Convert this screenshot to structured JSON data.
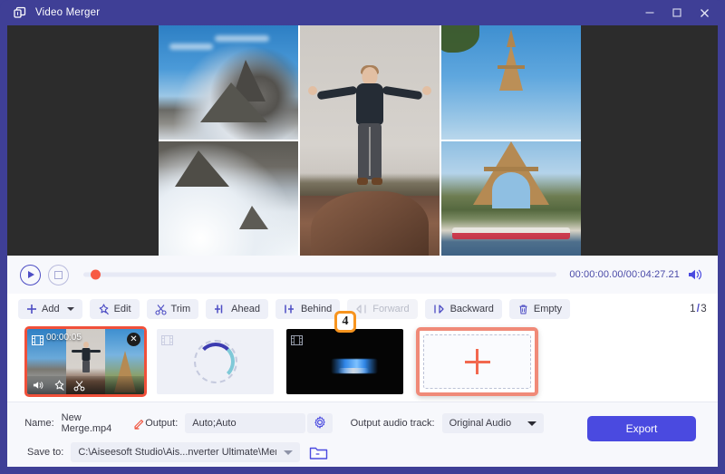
{
  "window": {
    "title": "Video Merger",
    "logo_icon": "windows-stack-icon",
    "controls": [
      {
        "name": "minimize-button",
        "icon": "minimize-icon"
      },
      {
        "name": "maximize-button",
        "icon": "maximize-icon"
      },
      {
        "name": "close-button",
        "icon": "close-icon"
      }
    ],
    "accent_color": "#3f3f96"
  },
  "preview": {
    "name": "video-preview",
    "background_color": "#2c2c2c",
    "collage": {
      "layout": "3-column collage",
      "cells": [
        {
          "name": "collage-cell-mountain-top",
          "subject": "snowy rocky mountain peak under blue sky"
        },
        {
          "name": "collage-cell-mountain-bottom",
          "subject": "snow field with rocky outcrops"
        },
        {
          "name": "collage-cell-man-jumping",
          "subject": "man jumping with arms outstretched above a rock"
        },
        {
          "name": "collage-cell-eiffel-top",
          "subject": "Eiffel Tower upper section against blue sky"
        },
        {
          "name": "collage-cell-eiffel-bottom",
          "subject": "Eiffel Tower base with Seine river boat"
        }
      ]
    }
  },
  "player": {
    "play_button": "play-button",
    "stop_button": "stop-button",
    "timecode": "00:00:00.00/00:04:27.21",
    "current_time": "00:00:00.00",
    "total_time": "00:04:27.21",
    "playhead_percent": 1,
    "volume_icon": "volume-icon"
  },
  "toolbar": {
    "buttons": [
      {
        "label": "Add",
        "icon": "plus-icon",
        "has_caret": true,
        "disabled": false,
        "name": "add-button"
      },
      {
        "label": "Edit",
        "icon": "magic-wand-icon",
        "has_caret": false,
        "disabled": false,
        "name": "edit-button"
      },
      {
        "label": "Trim",
        "icon": "scissors-icon",
        "has_caret": false,
        "disabled": false,
        "name": "trim-button"
      },
      {
        "label": "Ahead",
        "icon": "insert-ahead-icon",
        "has_caret": false,
        "disabled": false,
        "name": "ahead-button"
      },
      {
        "label": "Behind",
        "icon": "insert-behind-icon",
        "has_caret": false,
        "disabled": false,
        "name": "behind-button"
      },
      {
        "label": "Forward",
        "icon": "arrow-left-icon",
        "has_caret": false,
        "disabled": true,
        "name": "forward-button"
      },
      {
        "label": "Backward",
        "icon": "arrow-right-icon",
        "has_caret": false,
        "disabled": false,
        "name": "backward-button"
      },
      {
        "label": "Empty",
        "icon": "trash-icon",
        "has_caret": false,
        "disabled": false,
        "name": "empty-button"
      }
    ],
    "page_current": "1",
    "page_separator": "/",
    "page_total": "3"
  },
  "clips": [
    {
      "name": "clip-item-1",
      "kind": "collage",
      "duration": "00:00:05",
      "selected": true,
      "film_icon": "film-strip-icon",
      "close_icon": "close-circle-icon",
      "actions": [
        {
          "name": "clip-volume-icon",
          "icon": "volume-icon"
        },
        {
          "name": "clip-edit-icon",
          "icon": "magic-wand-icon"
        },
        {
          "name": "clip-trim-icon",
          "icon": "scissors-icon"
        }
      ]
    },
    {
      "name": "clip-item-2",
      "kind": "loading",
      "duration": "",
      "selected": false,
      "film_icon": "film-strip-icon",
      "spinner_icon": "loading-spinner-icon"
    },
    {
      "name": "clip-item-3",
      "kind": "black",
      "duration": "",
      "selected": false,
      "film_icon": "film-strip-icon"
    }
  ],
  "add_slot": {
    "name": "add-clip-slot",
    "icon": "plus-icon",
    "highlight_color": "#f08a78"
  },
  "annotation_badge": {
    "name": "step-badge-4",
    "label": "4",
    "border_color": "#f7941e"
  },
  "form": {
    "name_label": "Name:",
    "name_value": "New Merge.mp4",
    "name_edit_icon": "pencil-icon",
    "output_label": "Output:",
    "output_value": "Auto;Auto",
    "output_settings_icon": "gear-icon",
    "audio_track_label": "Output audio track:",
    "audio_track_value": "Original Audio",
    "save_to_label": "Save to:",
    "save_to_value": "C:\\Aiseesoft Studio\\Ais...nverter Ultimate\\Merger",
    "browse_icon": "folder-icon",
    "export_label": "Export",
    "export_color": "#4a4ae0"
  }
}
